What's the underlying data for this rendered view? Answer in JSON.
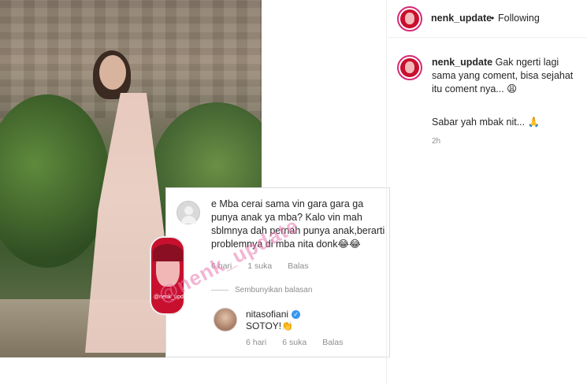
{
  "photo": {
    "description_icon": "woman-photo-icon"
  },
  "comment_card": {
    "comment_text": "e Mba cerai sama vin gara gara ga punya anak ya mba? Kalo vin mah sblmnya dah pernah punya anak,berarti problemnya di mba nita donk😂😂",
    "time": "6 hari",
    "likes": "1 suka",
    "reply_label": "Balas",
    "hide_replies": "Sembunyikan balasan",
    "reply": {
      "username": "nitasofiani",
      "text": "SOTOY!👏",
      "time": "6 hari",
      "likes": "6 suka",
      "reply_label": "Balas"
    }
  },
  "sticker": {
    "label": "@nenk_update"
  },
  "watermark": {
    "text": "@nenk_update"
  },
  "post": {
    "username": "nenk_update",
    "dot": "•",
    "follow_status": "Following",
    "caption_user": "nenk_update",
    "caption": "Gak ngerti lagi sama yang coment, bisa sejahat itu coment nya... 😩",
    "line2": "Sabar yah mbak nit... 🙏",
    "time": "2h"
  },
  "colors": {
    "accent_pink": "#d62976",
    "brand_red": "#c8102e",
    "verified_blue": "#3897f0",
    "watermark": "#e978af"
  }
}
